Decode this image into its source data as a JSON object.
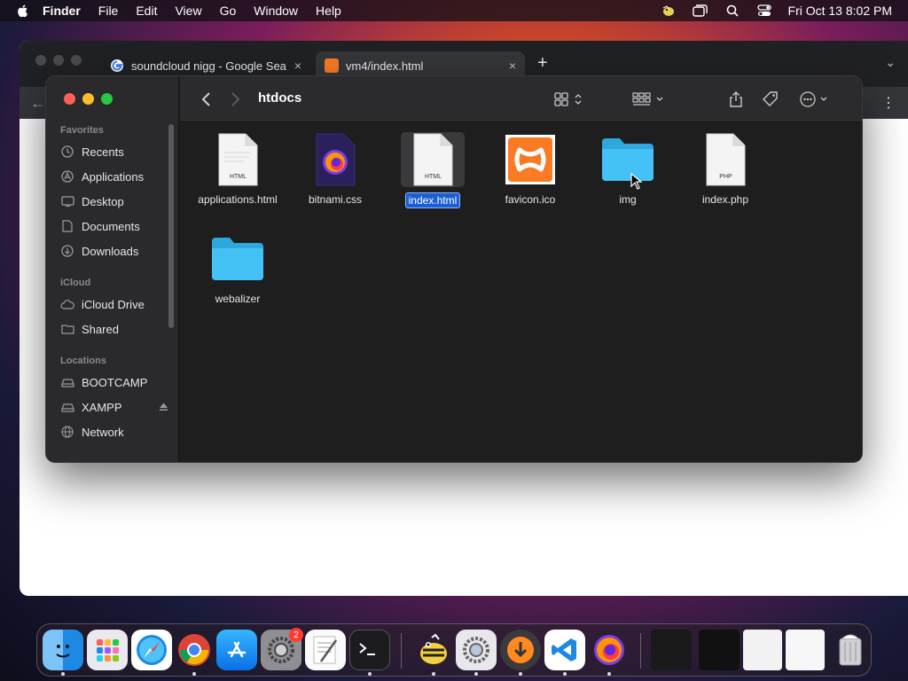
{
  "menubar": {
    "app_name": "Finder",
    "items": [
      "File",
      "Edit",
      "View",
      "Go",
      "Window",
      "Help"
    ],
    "clock": "Fri Oct 13  8:02 PM"
  },
  "browser": {
    "tabs": [
      {
        "title": "soundcloud nigg - Google Sea",
        "close": "×"
      },
      {
        "title": "vm4/index.html",
        "close": "×"
      }
    ],
    "new_tab": "+"
  },
  "finder": {
    "folder_title": "htdocs",
    "sidebar": {
      "favorites_header": "Favorites",
      "favorites": [
        {
          "label": "Recents",
          "icon": "clock-icon"
        },
        {
          "label": "Applications",
          "icon": "applications-icon"
        },
        {
          "label": "Desktop",
          "icon": "desktop-icon"
        },
        {
          "label": "Documents",
          "icon": "document-icon"
        },
        {
          "label": "Downloads",
          "icon": "download-icon"
        }
      ],
      "icloud_header": "iCloud",
      "icloud": [
        {
          "label": "iCloud Drive",
          "icon": "cloud-icon"
        },
        {
          "label": "Shared",
          "icon": "shared-folder-icon"
        }
      ],
      "locations_header": "Locations",
      "locations": [
        {
          "label": "BOOTCAMP",
          "icon": "drive-icon"
        },
        {
          "label": "XAMPP",
          "icon": "drive-icon"
        },
        {
          "label": "Network",
          "icon": "network-icon"
        }
      ]
    },
    "files": [
      {
        "name": "applications.html",
        "type": "html",
        "badge": "HTML"
      },
      {
        "name": "bitnami.css",
        "type": "css"
      },
      {
        "name": "index.html",
        "type": "html",
        "badge": "HTML",
        "selected": true
      },
      {
        "name": "favicon.ico",
        "type": "ico"
      },
      {
        "name": "img",
        "type": "folder"
      },
      {
        "name": "index.php",
        "type": "php",
        "badge": "PHP"
      },
      {
        "name": "webalizer",
        "type": "folder"
      }
    ]
  },
  "dock": {
    "apps": [
      "Finder",
      "Launchpad",
      "Safari",
      "Chrome",
      "App Store",
      "System Settings",
      "TextEdit",
      "Terminal",
      "Cyberduck",
      "Settings",
      "Downloader",
      "VS Code",
      "Firefox"
    ],
    "settings_badge": "2"
  },
  "colors": {
    "accent": "#1b5fd4",
    "folder": "#3fb9ef",
    "xampp": "#fb7a24"
  }
}
